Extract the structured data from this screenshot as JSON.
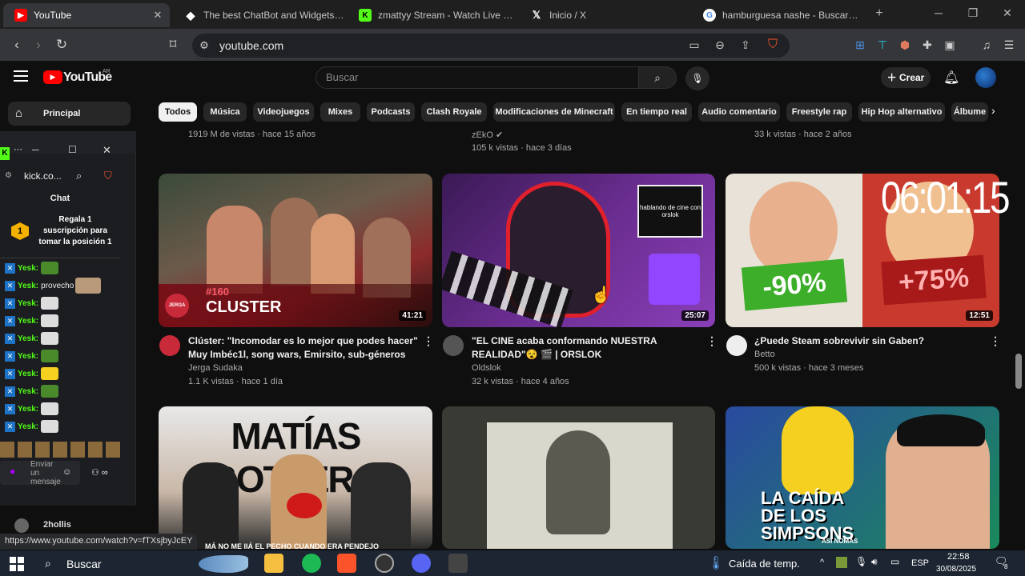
{
  "browser": {
    "tabs": [
      {
        "title": "YouTube",
        "icon": "youtube-icon",
        "active": true
      },
      {
        "title": "The best ChatBot and Widgets for",
        "icon": "streamelements-icon",
        "active": false
      },
      {
        "title": "zmattyy Stream - Watch Live on K",
        "icon": "kick-icon",
        "active": false
      },
      {
        "title": "Inicio / X",
        "icon": "x-icon",
        "active": false
      },
      {
        "title": "hamburguesa nashe - Buscar con",
        "icon": "google-icon",
        "active": false
      }
    ],
    "close_glyph": "✕",
    "new_tab_glyph": "+",
    "url": "youtube.com",
    "status_url": "https://www.youtube.com/watch?v=fTXsjbyJcEY"
  },
  "youtube": {
    "logo_text": "YouTube",
    "region": "AR",
    "search_placeholder": "Buscar",
    "create_label": "Crear",
    "sidebar_principal": "Principal",
    "chips": [
      "Todos",
      "Música",
      "Videojuegos",
      "Mixes",
      "Podcasts",
      "Clash Royale",
      "Modificaciones de Minecraft",
      "En tiempo real",
      "Audio comentario",
      "Freestyle rap",
      "Hip Hop alternativo",
      "Álbume"
    ],
    "top_row_meta": [
      {
        "channel": "",
        "stats": "1919 M de vistas · hace 15 años"
      },
      {
        "channel": "zEkO",
        "stats": "105 k vistas · hace 3 días"
      },
      {
        "channel": "",
        "stats": "33 k vistas · hace 2 años"
      }
    ],
    "videos": [
      {
        "title_line1": "Clúster: \"Incomodar es lo mejor que podes hacer\"",
        "title_line2": "Muy Imbéc1l, song wars, Emirsito, sub-géneros",
        "channel": "Jerga Sudaka",
        "stats": "1.1 K vistas · hace 1 día",
        "duration": "41:21",
        "thumb_text": "CLUSTER",
        "thumb_num": "#160",
        "thumb_brand": "JERGA"
      },
      {
        "title_line1": "\"EL CINE acaba conformando NUESTRA",
        "title_line2": "REALIDAD\"😵 🎬 | ORSLOK",
        "channel": "Oldslok",
        "stats": "32 k vistas · hace 4 años",
        "duration": "25:07",
        "thumb_text": "hablando de cine con orslok"
      },
      {
        "title_line1": "¿Puede Steam sobrevivir sin Gaben?",
        "title_line2": "",
        "channel": "Betto",
        "stats": "500 k vistas · hace 3 meses",
        "duration": "12:51",
        "thumb_left": "-90%",
        "thumb_right": "+75%"
      },
      {
        "thumb_text": "MATÍAS BOTTERO",
        "subtitle": "MÁ NO ME IIÁ EL PECHO CUANDO ERA PENDEJO"
      },
      {
        "thumb_text": ""
      },
      {
        "thumb_text": "LA CAÍDA DE LOS SIMPSONS",
        "thumb_small": "ASÍ NOMÁS"
      }
    ]
  },
  "overlay_clock": "06:01:15",
  "kick": {
    "tab_label": "kick.co...",
    "chat_header": "Chat",
    "gift_rank": "1",
    "gift_text": "Regala 1 suscripción para tomar la posición 1",
    "messages": [
      {
        "user": "Yesk:",
        "text": ""
      },
      {
        "user": "Yesk:",
        "text": "provecho"
      },
      {
        "user": "Yesk:",
        "text": ""
      },
      {
        "user": "Yesk:",
        "text": ""
      },
      {
        "user": "Yesk:",
        "text": ""
      },
      {
        "user": "Yesk:",
        "text": ""
      },
      {
        "user": "Yesk:",
        "text": ""
      },
      {
        "user": "Yesk:",
        "text": ""
      },
      {
        "user": "Yesk:",
        "text": ""
      },
      {
        "user": "Yesk:",
        "text": ""
      }
    ],
    "send_placeholder": "Enviar un mensaje",
    "viewer": "2hollis"
  },
  "taskbar": {
    "search_label": "Buscar",
    "weather": "Caída de temp.",
    "lang": "ESP",
    "time": "22:58",
    "date": "30/08/2025",
    "notifications": "8"
  },
  "colors": {
    "youtube_red": "#ff0000",
    "kick_green": "#53fc18",
    "chip_active": "#f1f1f1"
  }
}
